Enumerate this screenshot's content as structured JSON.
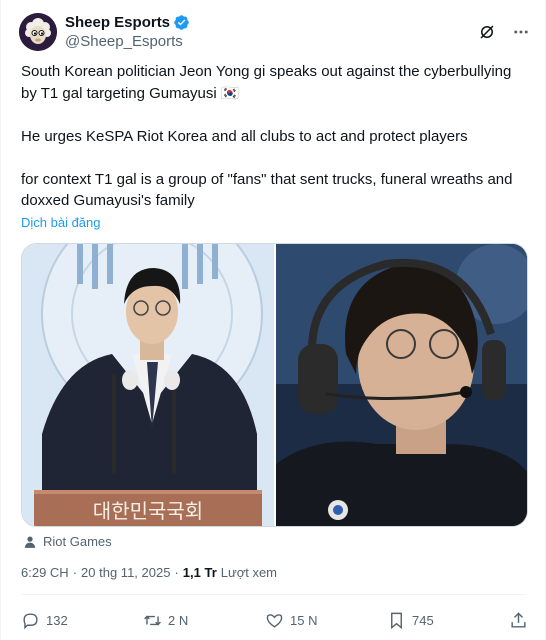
{
  "author": {
    "display_name": "Sheep Esports",
    "handle": "@Sheep_Esports",
    "verified": true,
    "avatar_icon": "sheep-logo-icon"
  },
  "post": {
    "text": "South Korean politician Jeon Yong gi speaks out against the cyberbullying by T1 gal targeting Gumayusi 🇰🇷\n\nHe urges KeSPA Riot Korea and all clubs to act and protect players\n\nfor context T1 gal is a group of \"fans\" that sent trucks, funeral wreaths and doxxed Gumayusi's family",
    "translate_label": "Dịch bài đăng",
    "media_credit": "Riot Games",
    "time": "6:29 CH",
    "date": "20 thg 11, 2025",
    "views_count": "1,1 Tr",
    "views_label": "Lượt xem"
  },
  "media": [
    {
      "alt": "politician-at-podium",
      "podium_text": "대한민국국회"
    },
    {
      "alt": "player-with-headset"
    }
  ],
  "actions": {
    "replies": "132",
    "reposts": "2 N",
    "likes": "15 N",
    "bookmarks": "745"
  },
  "colors": {
    "accent": "#1d9bf0",
    "muted": "#536471",
    "text": "#0f1419"
  }
}
